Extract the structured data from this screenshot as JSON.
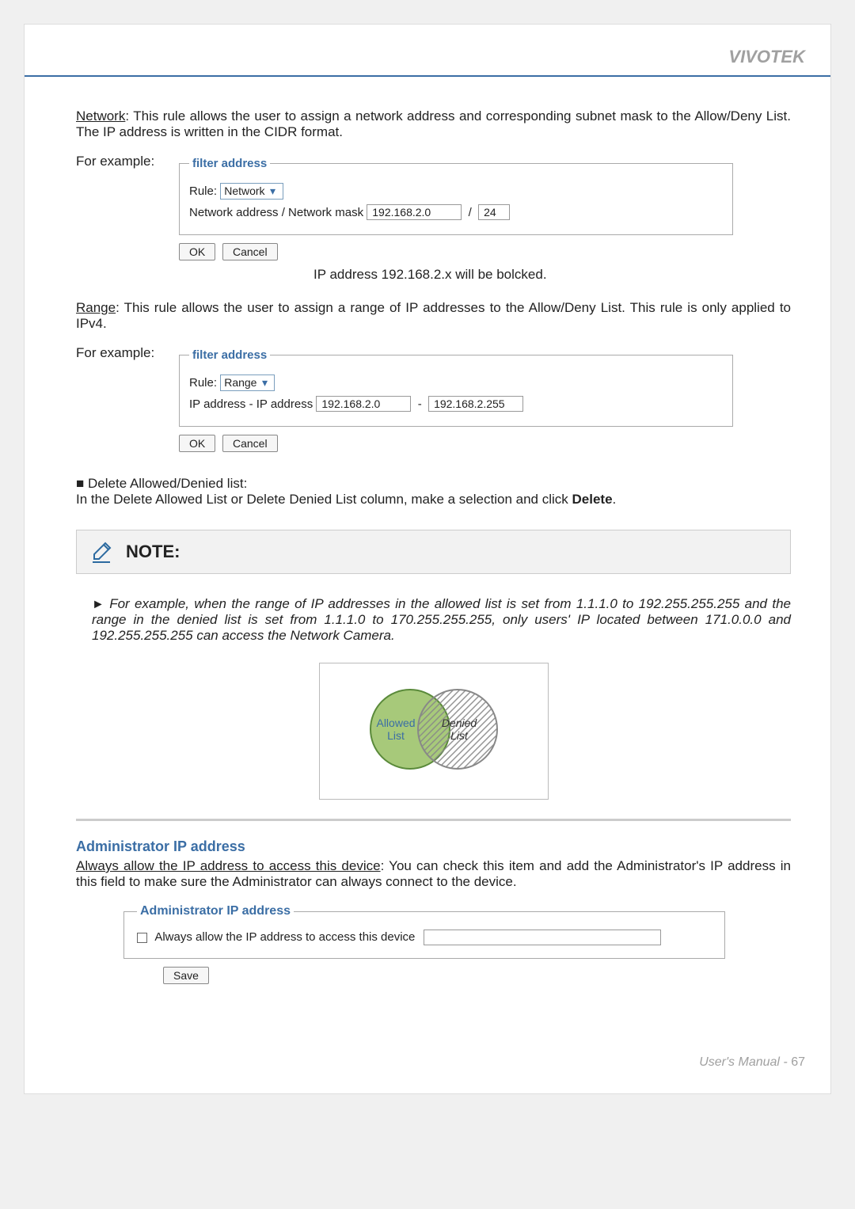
{
  "brand": "VIVOTEK",
  "network_rule": {
    "label": "Network",
    "text": ": This rule allows the user to assign a network address and corresponding subnet mask to the Allow/Deny List. The IP address is written in the CIDR format.",
    "example_label": "For example:",
    "fieldset_title": "filter address",
    "rule_label": "Rule:",
    "rule_value": "Network",
    "field_label": "Network address / Network mask",
    "addr_value": "192.168.2.0",
    "slash": "/",
    "mask_value": "24",
    "ok": "OK",
    "cancel": "Cancel",
    "callout": "IP address 192.168.2.x will be bolcked."
  },
  "range_rule": {
    "label": "Range",
    "text": ": This rule allows the user to assign a range of IP addresses to the Allow/Deny List. This rule is only applied to IPv4.",
    "example_label": "For example:",
    "fieldset_title": "filter address",
    "rule_label": "Rule:",
    "rule_value": "Range",
    "field_label": "IP address - IP address",
    "addr1": "192.168.2.0",
    "dash": "-",
    "addr2": "192.168.2.255",
    "ok": "OK",
    "cancel": "Cancel"
  },
  "delete_section": {
    "bullet": "■",
    "title": "Delete Allowed/Denied list:",
    "text_a": "In the Delete Allowed List or Delete Denied List column, make a selection and click ",
    "delete": "Delete",
    "text_b": "."
  },
  "note": {
    "title": "NOTE:",
    "arrow": "►",
    "body": "For example, when the range of IP addresses in the allowed list is set from 1.1.1.0 to 192.255.255.255 and the range in the denied list is set from 1.1.1.0 to 170.255.255.255, only users' IP located between 171.0.0.0 and 192.255.255.255 can access the Network Camera."
  },
  "venn": {
    "allowed_line1": "Allowed",
    "allowed_line2": "List",
    "denied_line1": "Denied",
    "denied_line2": "List"
  },
  "admin": {
    "heading": "Administrator IP address",
    "lead_u": "Always allow the IP address to access this device",
    "lead_rest": ": You can check this item and add the Administrator's IP address in this field to make sure the Administrator can always connect to the device.",
    "fieldset_title": "Administrator IP address",
    "checkbox_label": "Always allow the IP address to access this device"
  },
  "save": "Save",
  "footer": {
    "manual": "User's Manual - ",
    "page": "67"
  }
}
